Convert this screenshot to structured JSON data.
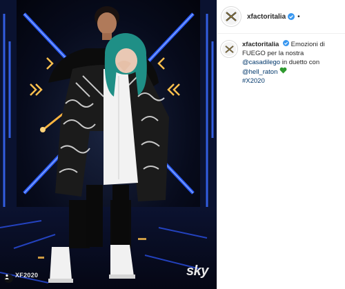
{
  "post": {
    "username": "xfactoritalia",
    "follow_dot": "•",
    "caption": {
      "part1": "Emozioni di FUEGO per la nostra ",
      "mention1": "@casadilego",
      "part2": " in duetto con ",
      "mention2": "@hell_raton",
      "hashtag": "#X2020"
    }
  },
  "photo": {
    "watermark_left": "XF2020",
    "watermark_right": "sky"
  },
  "icons": {
    "verified": "verified-badge-icon",
    "heart": "green-heart-emoji",
    "user_tag": "user-tag-icon",
    "avatar_logo": "x-factor-logo"
  },
  "colors": {
    "verified": "#3897f0",
    "heart": "#2f9a2f",
    "link": "#00376b",
    "stage_neon": "#2a5cff"
  }
}
